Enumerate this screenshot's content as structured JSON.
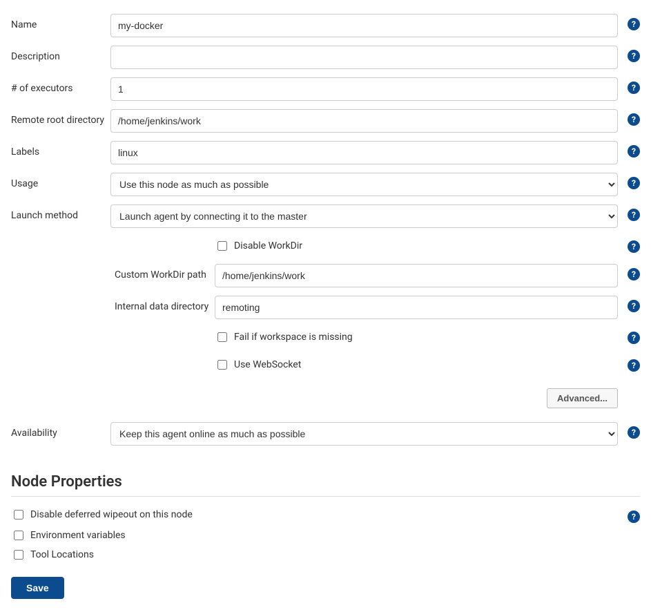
{
  "fields": {
    "name": {
      "label": "Name",
      "value": "my-docker"
    },
    "description": {
      "label": "Description",
      "value": ""
    },
    "executors": {
      "label": "# of executors",
      "value": "1"
    },
    "remote_root": {
      "label": "Remote root directory",
      "value": "/home/jenkins/work"
    },
    "labels": {
      "label": "Labels",
      "value": "linux"
    },
    "usage": {
      "label": "Usage",
      "selected": "Use this node as much as possible"
    },
    "launch_method": {
      "label": "Launch method",
      "selected": "Launch agent by connecting it to the master"
    },
    "disable_workdir": {
      "label": "Disable WorkDir",
      "checked": false
    },
    "custom_workdir": {
      "label": "Custom WorkDir path",
      "value": "/home/jenkins/work"
    },
    "internal_data_dir": {
      "label": "Internal data directory",
      "value": "remoting"
    },
    "fail_if_missing": {
      "label": "Fail if workspace is missing",
      "checked": false
    },
    "use_websocket": {
      "label": "Use WebSocket",
      "checked": false
    },
    "availability": {
      "label": "Availability",
      "selected": "Keep this agent online as much as possible"
    }
  },
  "advanced_button": "Advanced...",
  "node_properties": {
    "heading": "Node Properties",
    "items": [
      {
        "label": "Disable deferred wipeout on this node",
        "has_help": true
      },
      {
        "label": "Environment variables",
        "has_help": false
      },
      {
        "label": "Tool Locations",
        "has_help": false
      }
    ]
  },
  "save_button": "Save",
  "help_glyph": "?"
}
